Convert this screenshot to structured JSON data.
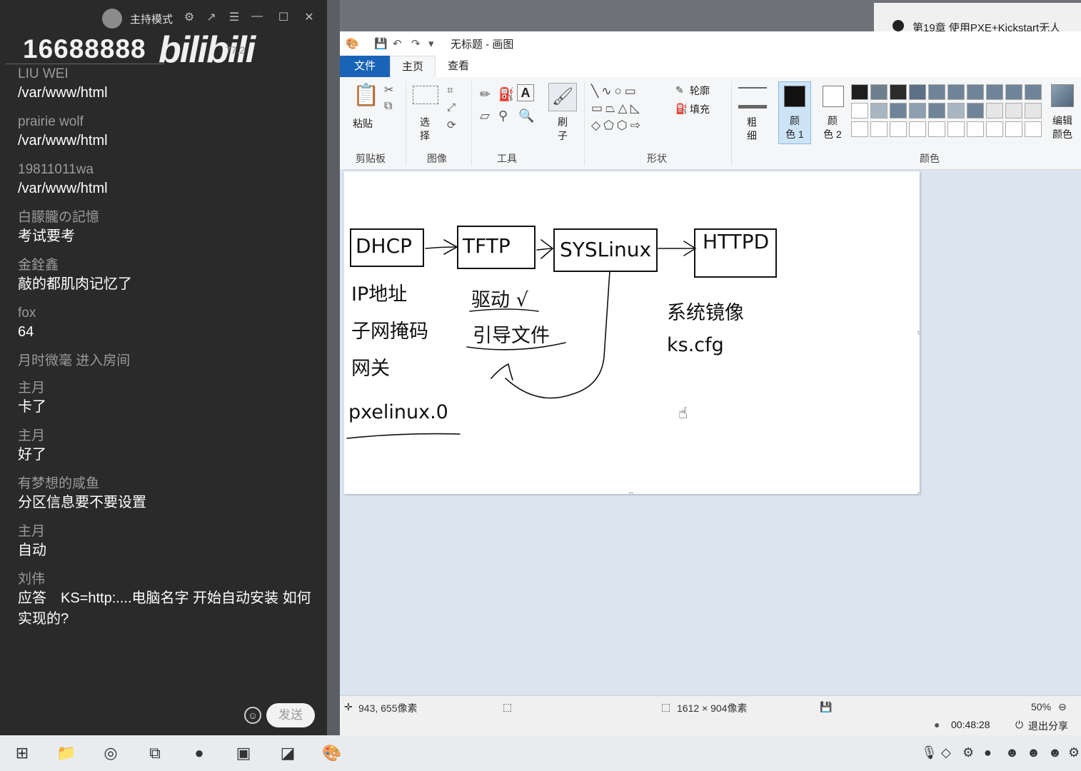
{
  "chat": {
    "mode_label": "主持模式",
    "room_id": "16688888",
    "logo": "bilibili",
    "logo_sub": "77.2",
    "messages": [
      {
        "user": "LIU WEI",
        "text": "/var/www/html"
      },
      {
        "user": "prairie wolf",
        "text": "/var/www/html"
      },
      {
        "user": "19811011wa",
        "text": "/var/www/html"
      },
      {
        "user": "白朦朧の記憶",
        "text": "考试要考"
      },
      {
        "user": "金銓鑫",
        "text": "敲的都肌肉记忆了"
      },
      {
        "user": "fox",
        "text": "64"
      },
      {
        "user": "月时微毫 进入房间",
        "text": ""
      },
      {
        "user": "主月",
        "text": "卡了"
      },
      {
        "user": "主月",
        "text": "好了"
      },
      {
        "user": "有梦想的咸鱼",
        "text": "分区信息要不要设置"
      },
      {
        "user": "主月",
        "text": "自动"
      },
      {
        "user": "刘伟",
        "text": "应答　KS=http:....电脑名字  开始自动安装  如何实现的?"
      }
    ],
    "send_label": "发送"
  },
  "background_window": {
    "title": "第19章 使用PXE+Kickstart无人"
  },
  "paint": {
    "title": "无标题 - 画图",
    "tabs": {
      "file": "文件",
      "home": "主页",
      "view": "查看"
    },
    "ribbon": {
      "paste": "粘贴",
      "select": "选\n择",
      "brush": "刷\n子",
      "outline": "轮廓",
      "fill": "填充",
      "size": "粗\n细",
      "color1": "颜\n色 1",
      "color2": "颜\n色 2",
      "edit_colors": "编辑\n颜色",
      "groups": {
        "clipboard": "剪贴板",
        "image": "图像",
        "tools": "工具",
        "shapes": "形状",
        "colors": "颜色"
      }
    },
    "palette_row1": [
      "#1e1e1e",
      "#6e7f8e",
      "#2b2b2b",
      "#5c7185",
      "#6f8498",
      "#6f8498",
      "#6f8498",
      "#6f8498",
      "#6f8498",
      "#6f8498"
    ],
    "palette_row2": [
      "#ffffff",
      "#a9b6c2",
      "#6f8498",
      "#8d9fb0",
      "#6f8498",
      "#a9b6c2",
      "#6f8498",
      "#e6e6e6",
      "#e6e6e6",
      "#e6e6e6"
    ],
    "palette_row3": [
      "#ffffff",
      "#ffffff",
      "#ffffff",
      "#ffffff",
      "#ffffff",
      "#ffffff",
      "#ffffff",
      "#ffffff",
      "#ffffff",
      "#ffffff"
    ],
    "diagram": {
      "nodes": [
        "DHCP",
        "TFTP",
        "SYSLinux",
        "HTTPD"
      ],
      "dhcp_notes": [
        "IP地址",
        "子网掩码",
        "网关"
      ],
      "tftp_notes": [
        "驱动 √",
        "引导文件"
      ],
      "httpd_notes": [
        "系统镜像",
        "ks.cfg"
      ],
      "bottom_note": "pxelinux.0"
    },
    "status": {
      "cursor_pos": "943, 655像素",
      "canvas_size": "1612 × 904像素",
      "zoom": "50%"
    },
    "share": {
      "time": "00:48:28",
      "exit": "退出分享"
    }
  }
}
